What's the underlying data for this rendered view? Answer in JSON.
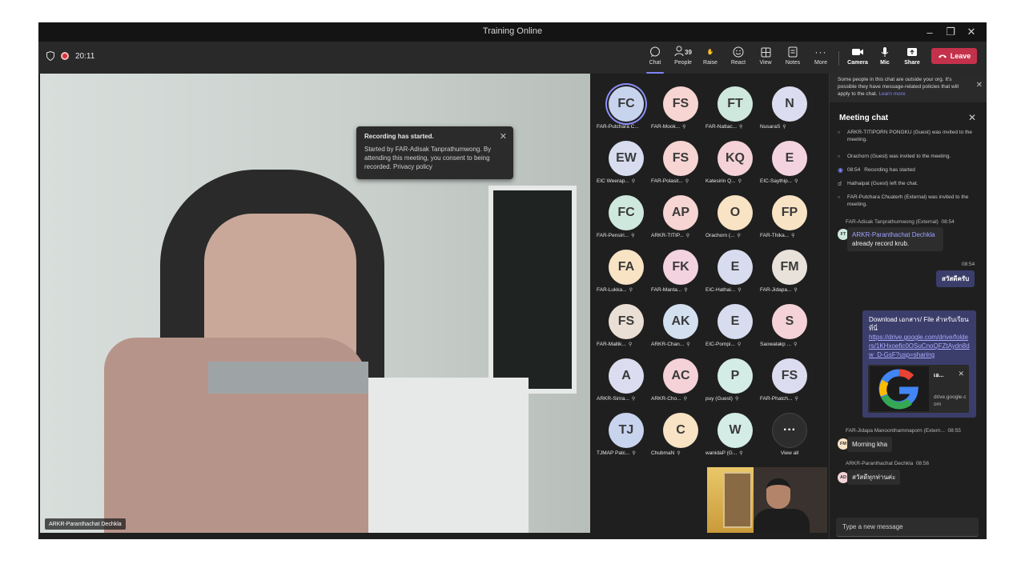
{
  "window": {
    "title": "Training Online"
  },
  "toolbar": {
    "timer": "20:11",
    "people_count": "39",
    "buttons": [
      {
        "label": "Chat",
        "icon": "chat-icon"
      },
      {
        "label": "People",
        "icon": "people-icon"
      },
      {
        "label": "Raise",
        "icon": "raise-hand-icon"
      },
      {
        "label": "React",
        "icon": "react-icon"
      },
      {
        "label": "View",
        "icon": "view-icon"
      },
      {
        "label": "Notes",
        "icon": "notes-icon"
      },
      {
        "label": "More",
        "icon": "more-icon"
      },
      {
        "label": "Camera",
        "icon": "camera-icon"
      },
      {
        "label": "Mic",
        "icon": "mic-icon"
      },
      {
        "label": "Share",
        "icon": "share-icon"
      }
    ],
    "leave_label": "Leave"
  },
  "main_video": {
    "name": "ARKR-Paranthachat Dechkla"
  },
  "recording_popup": {
    "title": "Recording has started.",
    "body": "Started by FAR-Adisak Tanprathumwong. By attending this meeting, you consent to being recorded. Privacy policy"
  },
  "participants": [
    {
      "initials": "FC",
      "name": "FAR-Putchara C...",
      "color": "#c8d3ee",
      "selected": true,
      "mic": false
    },
    {
      "initials": "FS",
      "name": "FAR-Mook...",
      "color": "#f6d5d2",
      "mic": true
    },
    {
      "initials": "FT",
      "name": "FAR-Nattac...",
      "color": "#cfe8dd",
      "mic": true
    },
    {
      "initials": "N",
      "name": "NusaraS",
      "color": "#dcdcf0",
      "mic": true
    },
    {
      "initials": "EW",
      "name": "EIC Weerap...",
      "color": "#d8dcef",
      "mic": true
    },
    {
      "initials": "FS",
      "name": "FAR-Polasit...",
      "color": "#f6d5d2",
      "mic": true
    },
    {
      "initials": "KQ",
      "name": "Katesirin Q...",
      "color": "#f4d2d8",
      "mic": true
    },
    {
      "initials": "E",
      "name": "EIC-Saythip...",
      "color": "#f4d3e0",
      "mic": true
    },
    {
      "initials": "FC",
      "name": "FAR-Pensiri...",
      "color": "#cfe8dd",
      "mic": true
    },
    {
      "initials": "AP",
      "name": "ARKR-TITIP...",
      "color": "#f6d5d2",
      "mic": true
    },
    {
      "initials": "O",
      "name": "Orachorn (...",
      "color": "#f8e3c4",
      "mic": true
    },
    {
      "initials": "FP",
      "name": "FAR-Thika...",
      "color": "#f8e3c4",
      "mic": true
    },
    {
      "initials": "FA",
      "name": "FAR-Lukka...",
      "color": "#f8e3c4",
      "mic": true
    },
    {
      "initials": "FK",
      "name": "FAR-Manta...",
      "color": "#f4d3e0",
      "mic": true
    },
    {
      "initials": "E",
      "name": "EIC-Hathai...",
      "color": "#d8dcef",
      "mic": true
    },
    {
      "initials": "FM",
      "name": "FAR-Jidapa...",
      "color": "#e8e2da",
      "mic": true
    },
    {
      "initials": "FS",
      "name": "FAR-Mallik...",
      "color": "#eadfd5",
      "mic": true
    },
    {
      "initials": "AK",
      "name": "ARKR-Chan...",
      "color": "#d3e0f0",
      "mic": true
    },
    {
      "initials": "E",
      "name": "EIC-Pompi...",
      "color": "#d8dcef",
      "mic": true
    },
    {
      "initials": "S",
      "name": "Saowalakp ...",
      "color": "#f4d2d8",
      "mic": true
    },
    {
      "initials": "A",
      "name": "ARKR-Sirira...",
      "color": "#dcdcf0",
      "mic": true
    },
    {
      "initials": "AC",
      "name": "ARKR-Cho...",
      "color": "#f4d2d8",
      "mic": true
    },
    {
      "initials": "P",
      "name": "puy (Guest)",
      "color": "#d3ece6",
      "mic": true
    },
    {
      "initials": "FS",
      "name": "FAR-Phatch...",
      "color": "#dcdcf0",
      "mic": true
    },
    {
      "initials": "TJ",
      "name": "TJMAP Patc...",
      "color": "#c8d3ee",
      "mic": true
    },
    {
      "initials": "C",
      "name": "ChubmaN",
      "color": "#f8e3c4",
      "mic": true
    },
    {
      "initials": "W",
      "name": "wanidaP (G...",
      "color": "#d3ece6",
      "mic": true
    }
  ],
  "view_all": {
    "glyph": "···",
    "label": "View all"
  },
  "chat": {
    "notice": "Some people in this chat are outside your org. It's possible they have message-related policies that will apply to the chat.",
    "notice_link": "Learn more",
    "title": "Meeting chat",
    "system_messages": [
      "ARKR-TITIPORN PONGKU (Guest) was invited to the meeting.",
      "Orachorn (Guest) was invited to the meeting.",
      "Recording has started",
      "Hathaipat (Guest) left the chat.",
      "FAR-Putchara Chuaterh (External) was invited to the meeting."
    ],
    "recording_time": "08:54",
    "msg1": {
      "author": "FAR-Adisak Tanprathumwong (External)",
      "time": "08:54",
      "initials": "FT",
      "mention": "ARKR-Paranthachat Dechkla",
      "text": "already record krub."
    },
    "my_time": "08:54",
    "my_msg1": "สวัสดีครับ",
    "download": {
      "text": "Download เอกสาร/ File สำหรับเรียน ที่นี่",
      "link": "https://drive.google.com/drive/folders/1KHxoefic0OSuCnoQFZtAydn8dw_D-GsF?usp=sharing",
      "preview_title": "เอ...",
      "preview_domain": "drive.google.com"
    },
    "msg2": {
      "author": "FAR-Jidapa Manoonthammaporn (Extern...",
      "time": "08:55",
      "initials": "FM",
      "text": "Morning kha"
    },
    "msg3": {
      "author": "ARKR-Paranthachat Dechkla",
      "time": "08:56",
      "initials": "AD",
      "text": "สวัสดีทุกท่านค่ะ"
    },
    "composer_placeholder": "Type a new message"
  }
}
